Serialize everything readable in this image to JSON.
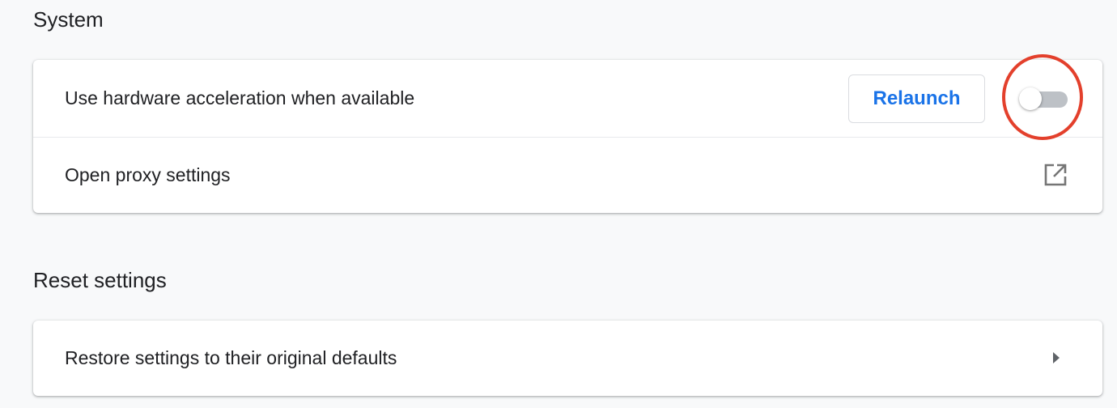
{
  "system": {
    "title": "System",
    "hardware_acceleration": {
      "label": "Use hardware acceleration when available",
      "relaunch_label": "Relaunch",
      "enabled": false
    },
    "proxy": {
      "label": "Open proxy settings",
      "icon": "open-in-new-icon"
    }
  },
  "reset": {
    "title": "Reset settings",
    "restore": {
      "label": "Restore settings to their original defaults",
      "icon": "chevron-right-icon"
    }
  },
  "colors": {
    "accent": "#1a73e8",
    "highlight": "#e3402c",
    "toggle_off_track": "#bdc1c6"
  }
}
